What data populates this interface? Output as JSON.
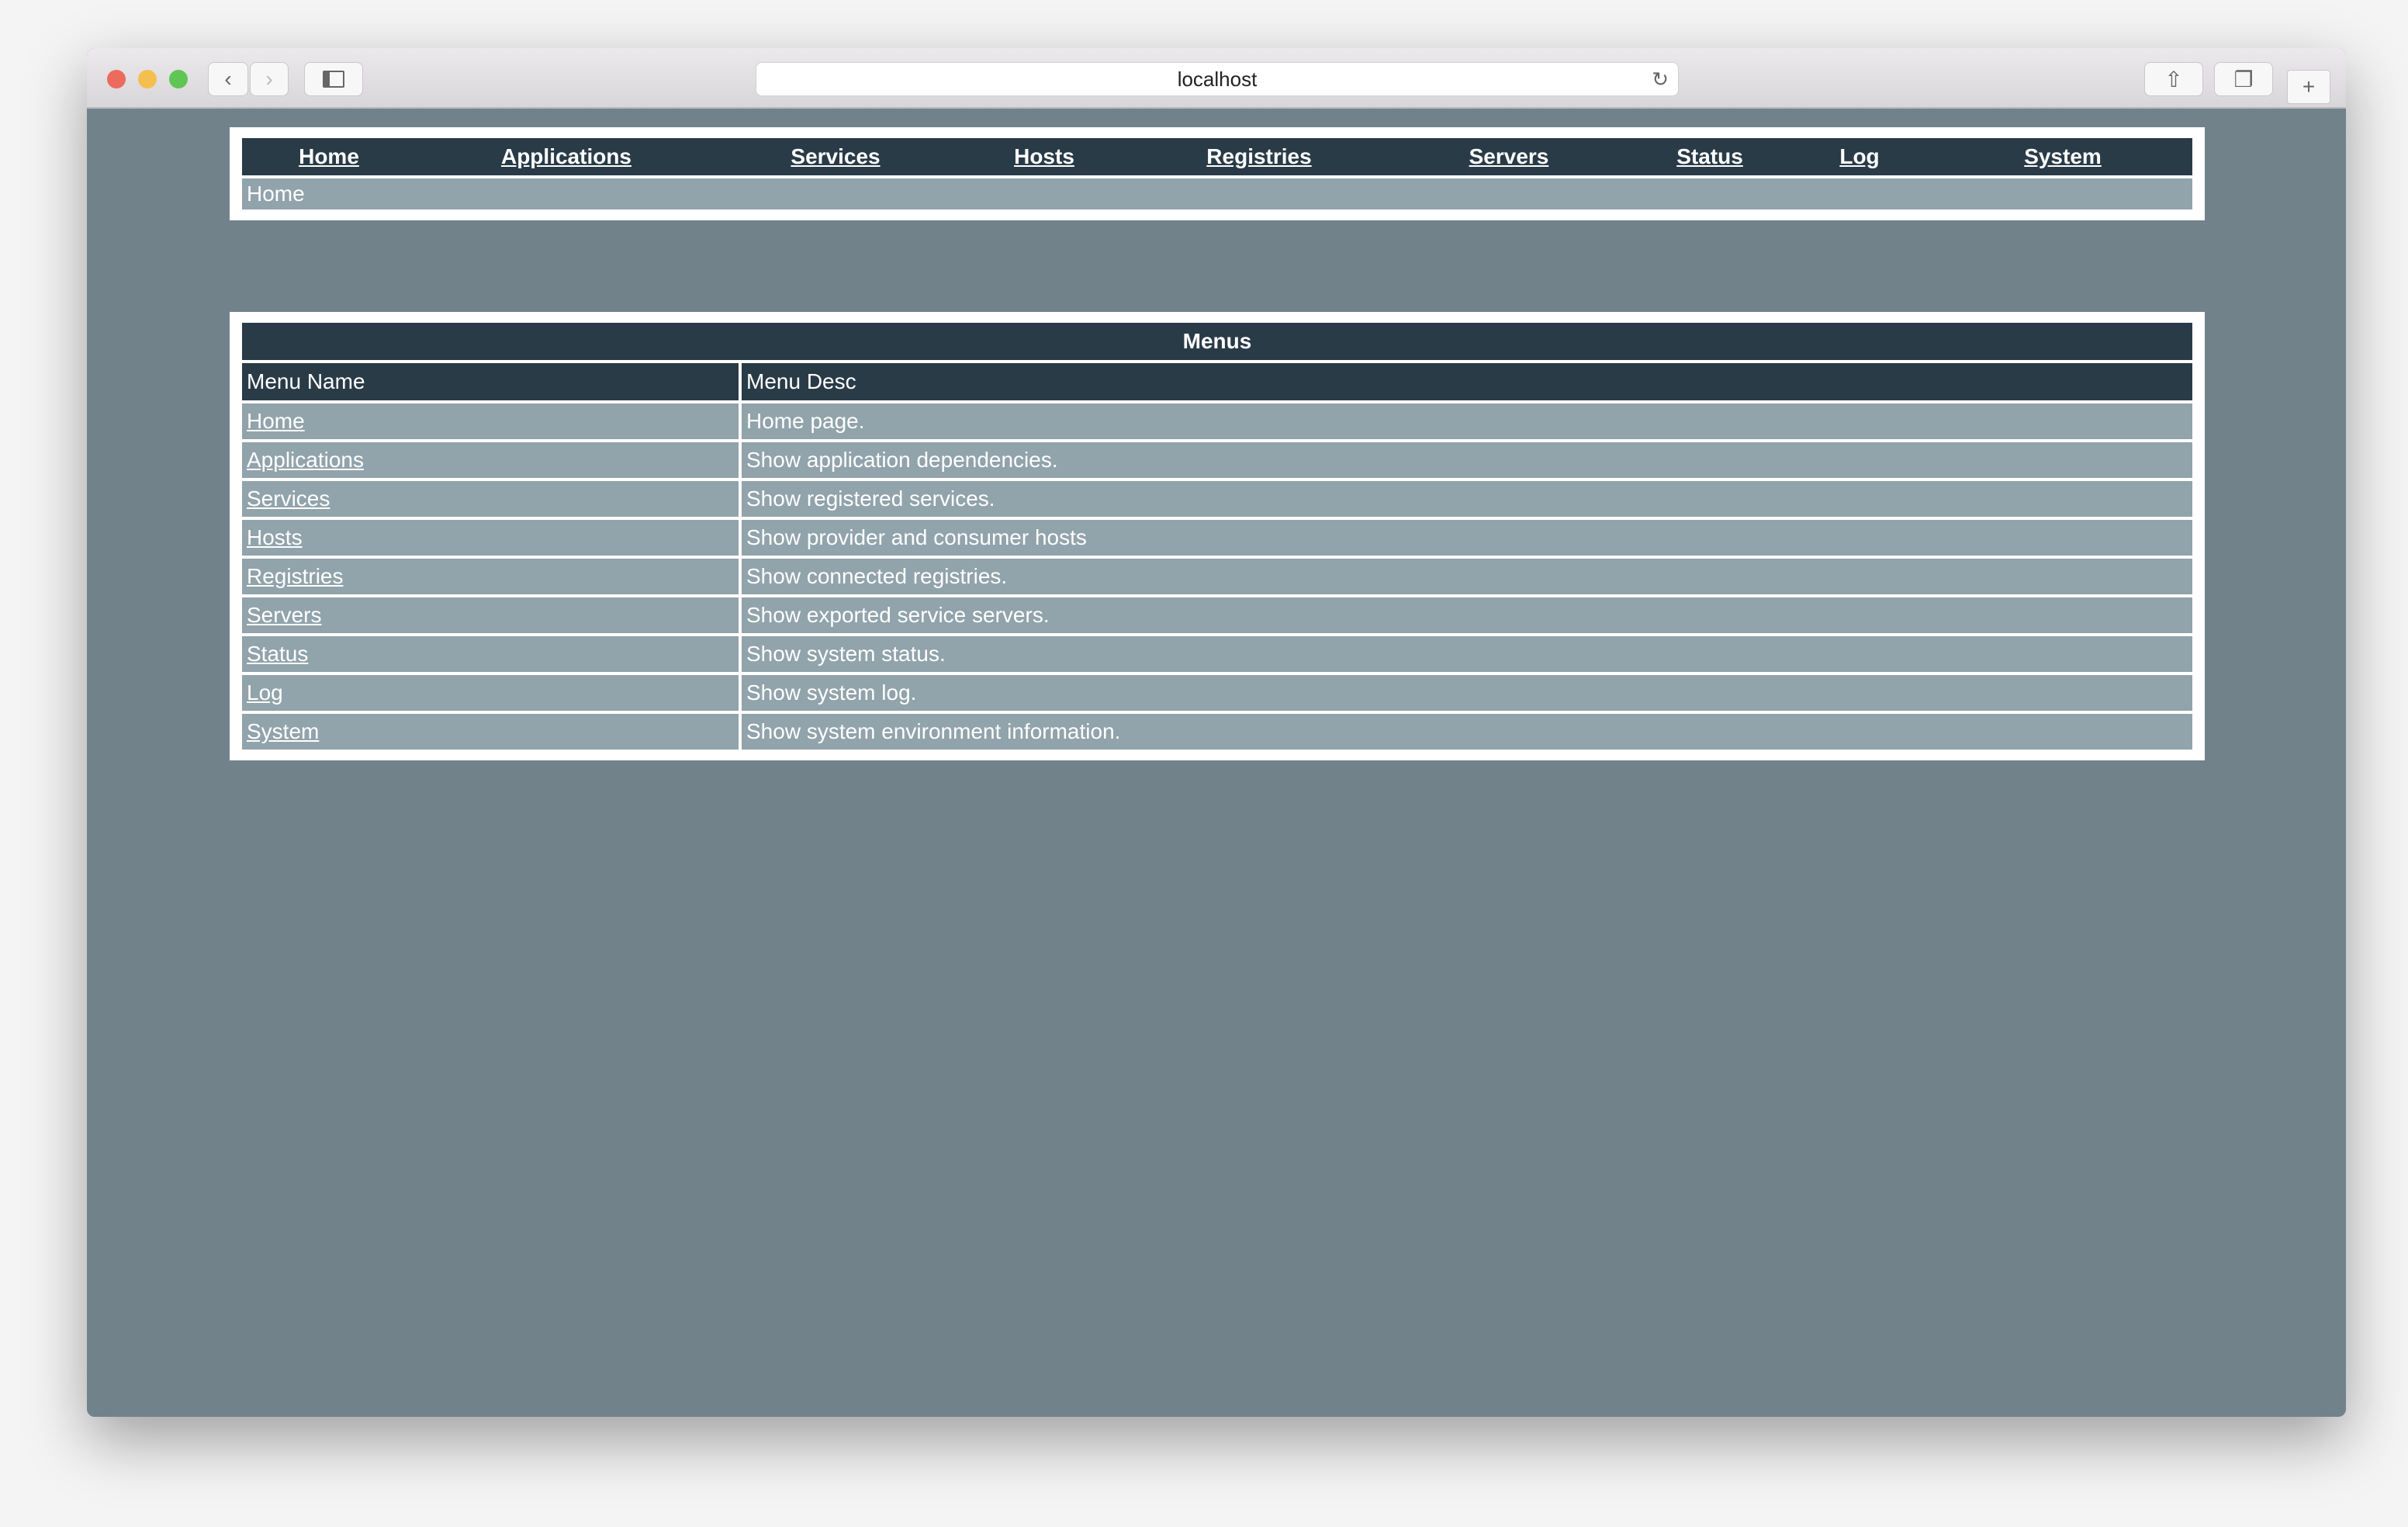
{
  "browser": {
    "url": "localhost",
    "colors": {
      "close": "#ec6a5e",
      "minimize": "#f4bf4f",
      "zoom": "#61c554"
    }
  },
  "nav": {
    "items": [
      "Home",
      "Applications",
      "Services",
      "Hosts",
      "Registries",
      "Servers",
      "Status",
      "Log",
      "System"
    ],
    "breadcrumb": "Home"
  },
  "menus": {
    "title": "Menus",
    "columns": [
      "Menu Name",
      "Menu Desc"
    ],
    "rows": [
      {
        "name": "Home",
        "desc": "Home page."
      },
      {
        "name": "Applications",
        "desc": "Show application dependencies."
      },
      {
        "name": "Services",
        "desc": "Show registered services."
      },
      {
        "name": "Hosts",
        "desc": "Show provider and consumer hosts"
      },
      {
        "name": "Registries",
        "desc": "Show connected registries."
      },
      {
        "name": "Servers",
        "desc": "Show exported service servers."
      },
      {
        "name": "Status",
        "desc": "Show system status."
      },
      {
        "name": "Log",
        "desc": "Show system log."
      },
      {
        "name": "System",
        "desc": "Show system environment information."
      }
    ]
  },
  "colors": {
    "header": "#293b47",
    "row": "#91a3ab",
    "background": "#71828a"
  }
}
